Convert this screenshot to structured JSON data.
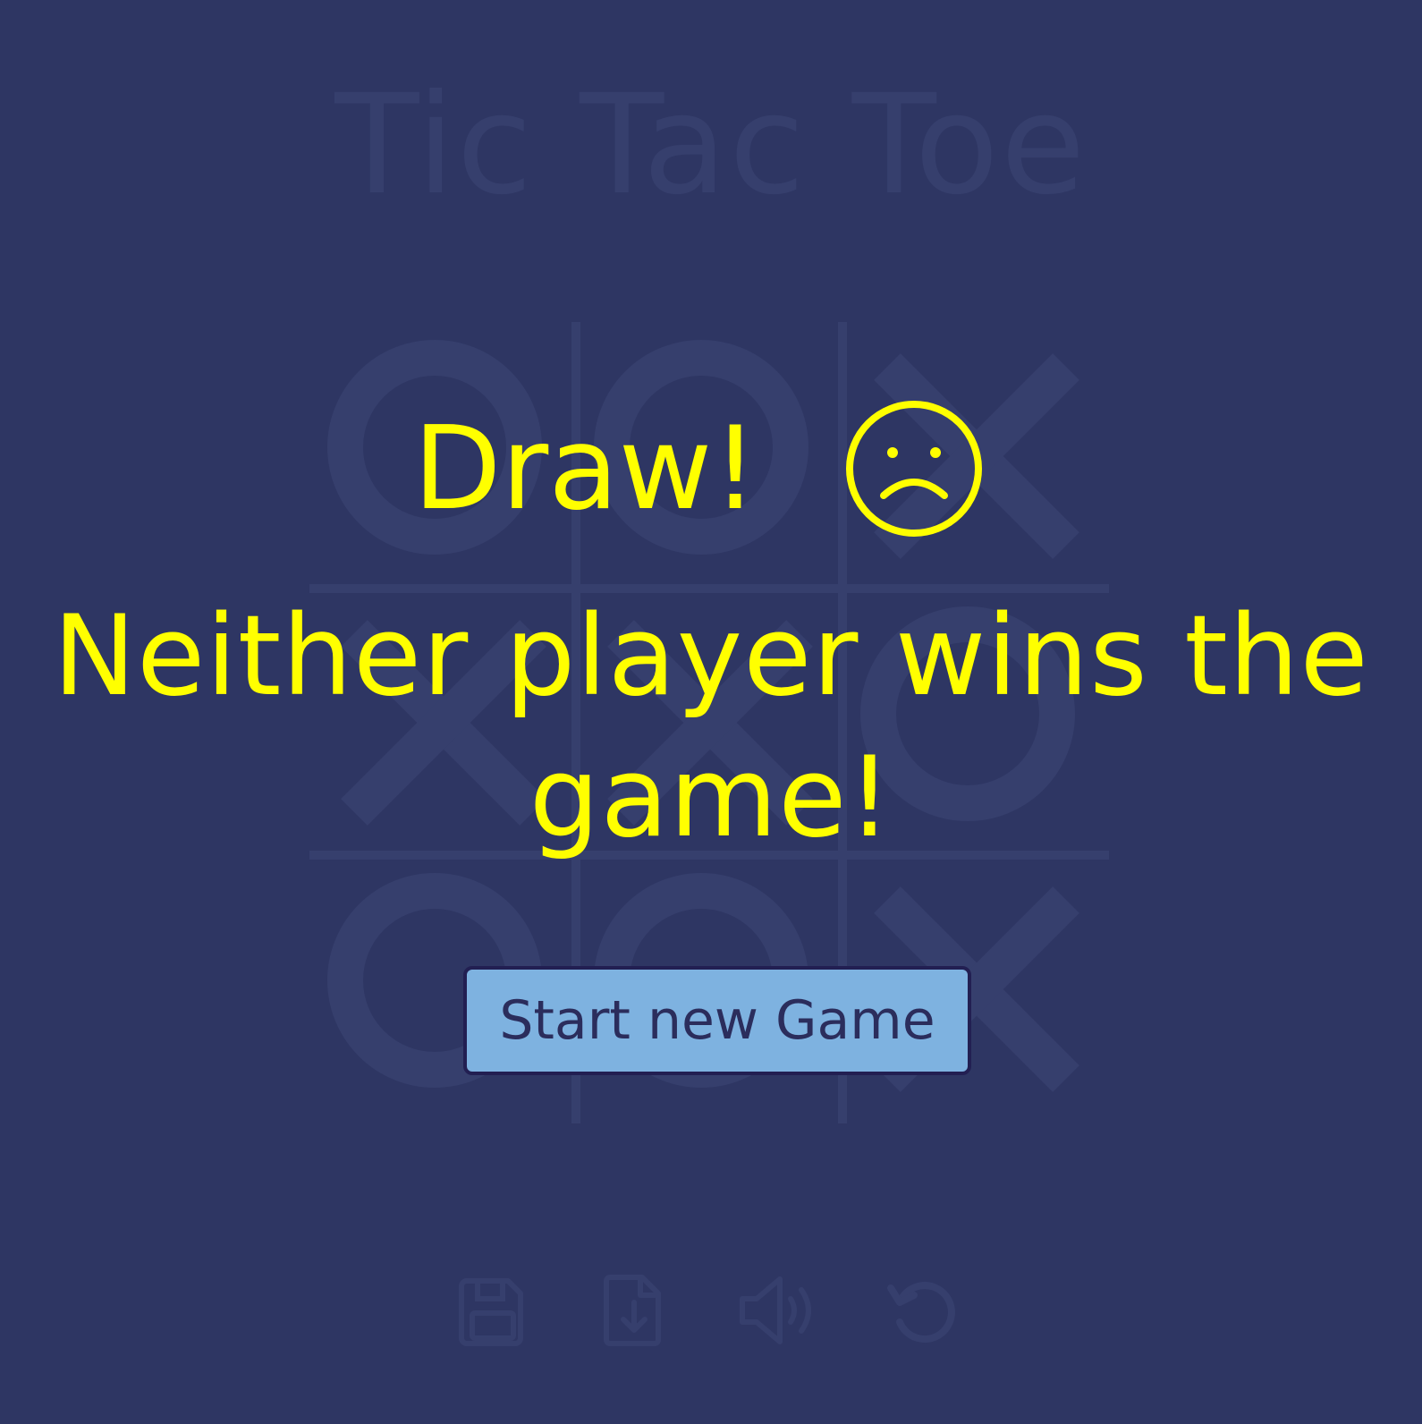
{
  "app": {
    "title": "Tic Tac Toe"
  },
  "board": {
    "cells": [
      "O",
      "O",
      "X",
      "X",
      "X",
      "O",
      "O",
      "O",
      "X"
    ]
  },
  "toolbar": {
    "items": [
      {
        "name": "save",
        "icon": "floppy-disk-icon"
      },
      {
        "name": "load",
        "icon": "file-download-icon"
      },
      {
        "name": "sound",
        "icon": "speaker-icon"
      },
      {
        "name": "undo",
        "icon": "undo-icon"
      }
    ]
  },
  "result": {
    "title": "Draw!",
    "icon": "sad-face-icon",
    "message": "Neither player wins the game!",
    "button_label": "Start new Game"
  },
  "colors": {
    "background": "#2e3663",
    "faded": "#363f6d",
    "accent": "#ffff00",
    "button": "#7eb2e0",
    "button_text": "#2b2d5c"
  }
}
